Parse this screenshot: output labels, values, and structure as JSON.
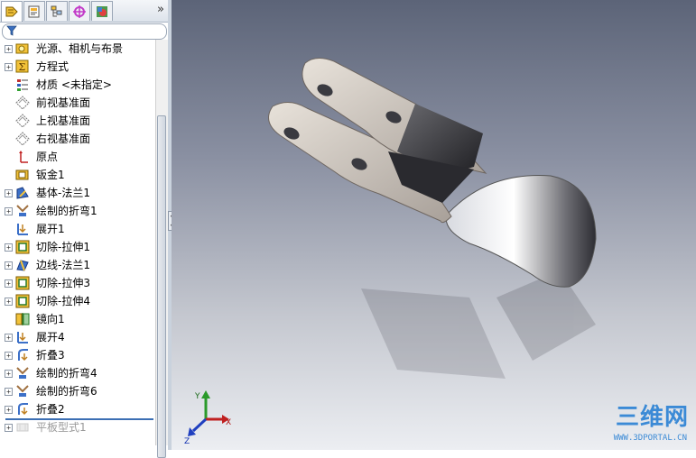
{
  "panel": {
    "tabs": [
      "feature-manager",
      "property-manager",
      "configuration-manager",
      "dimxpert-manager",
      "display-manager"
    ],
    "more_glyph": "»"
  },
  "tree": [
    {
      "label": "光源、相机与布景",
      "icon": "lights-cameras-icon",
      "expandable": true
    },
    {
      "label": "方程式",
      "icon": "equations-icon",
      "expandable": true
    },
    {
      "label": "材质 <未指定>",
      "icon": "material-icon",
      "expandable": false
    },
    {
      "label": "前视基准面",
      "icon": "plane-icon",
      "expandable": false
    },
    {
      "label": "上视基准面",
      "icon": "plane-icon",
      "expandable": false
    },
    {
      "label": "右视基准面",
      "icon": "plane-icon",
      "expandable": false
    },
    {
      "label": "原点",
      "icon": "origin-icon",
      "expandable": false
    },
    {
      "label": "钣金1",
      "icon": "sheet-metal-icon",
      "expandable": false
    },
    {
      "label": "基体-法兰1",
      "icon": "base-flange-icon",
      "expandable": true
    },
    {
      "label": "绘制的折弯1",
      "icon": "sketched-bend-icon",
      "expandable": true
    },
    {
      "label": "展开1",
      "icon": "unfold-icon",
      "expandable": false
    },
    {
      "label": "切除-拉伸1",
      "icon": "cut-extrude-icon",
      "expandable": true
    },
    {
      "label": "边线-法兰1",
      "icon": "edge-flange-icon",
      "expandable": true
    },
    {
      "label": "切除-拉伸3",
      "icon": "cut-extrude-icon",
      "expandable": true
    },
    {
      "label": "切除-拉伸4",
      "icon": "cut-extrude-icon",
      "expandable": true
    },
    {
      "label": "镜向1",
      "icon": "mirror-icon",
      "expandable": false
    },
    {
      "label": "展开4",
      "icon": "unfold-icon",
      "expandable": true
    },
    {
      "label": "折叠3",
      "icon": "fold-icon",
      "expandable": true
    },
    {
      "label": "绘制的折弯4",
      "icon": "sketched-bend-icon",
      "expandable": true
    },
    {
      "label": "绘制的折弯6",
      "icon": "sketched-bend-icon",
      "expandable": true
    },
    {
      "label": "折叠2",
      "icon": "fold-icon",
      "expandable": true
    },
    {
      "label": "平板型式1",
      "icon": "flat-pattern-icon",
      "expandable": true,
      "disabled": true
    }
  ],
  "viewport": {
    "triad": {
      "x": "X",
      "y": "Y",
      "z": "Z"
    },
    "watermark": "三维网",
    "watermark_sub": "WWW.3DPORTAL.CN"
  },
  "colors": {
    "viewport_top": "#5c6478",
    "viewport_bottom": "#eceef2",
    "selection_bar": "#3c6fb4",
    "watermark": "#3b8ad6"
  }
}
